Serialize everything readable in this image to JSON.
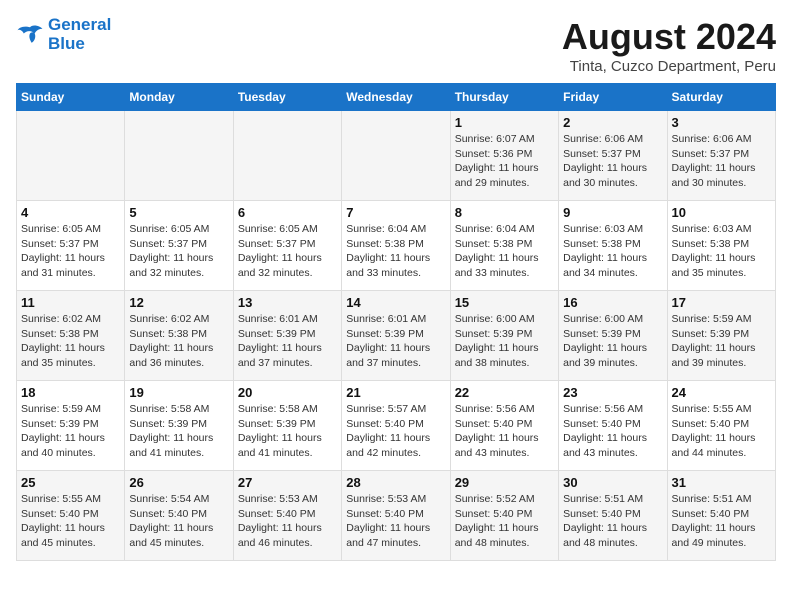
{
  "header": {
    "logo_line1": "General",
    "logo_line2": "Blue",
    "main_title": "August 2024",
    "sub_title": "Tinta, Cuzco Department, Peru"
  },
  "columns": [
    "Sunday",
    "Monday",
    "Tuesday",
    "Wednesday",
    "Thursday",
    "Friday",
    "Saturday"
  ],
  "weeks": [
    [
      {
        "day": "",
        "info": ""
      },
      {
        "day": "",
        "info": ""
      },
      {
        "day": "",
        "info": ""
      },
      {
        "day": "",
        "info": ""
      },
      {
        "day": "1",
        "info": "Sunrise: 6:07 AM\nSunset: 5:36 PM\nDaylight: 11 hours\nand 29 minutes."
      },
      {
        "day": "2",
        "info": "Sunrise: 6:06 AM\nSunset: 5:37 PM\nDaylight: 11 hours\nand 30 minutes."
      },
      {
        "day": "3",
        "info": "Sunrise: 6:06 AM\nSunset: 5:37 PM\nDaylight: 11 hours\nand 30 minutes."
      }
    ],
    [
      {
        "day": "4",
        "info": "Sunrise: 6:05 AM\nSunset: 5:37 PM\nDaylight: 11 hours\nand 31 minutes."
      },
      {
        "day": "5",
        "info": "Sunrise: 6:05 AM\nSunset: 5:37 PM\nDaylight: 11 hours\nand 32 minutes."
      },
      {
        "day": "6",
        "info": "Sunrise: 6:05 AM\nSunset: 5:37 PM\nDaylight: 11 hours\nand 32 minutes."
      },
      {
        "day": "7",
        "info": "Sunrise: 6:04 AM\nSunset: 5:38 PM\nDaylight: 11 hours\nand 33 minutes."
      },
      {
        "day": "8",
        "info": "Sunrise: 6:04 AM\nSunset: 5:38 PM\nDaylight: 11 hours\nand 33 minutes."
      },
      {
        "day": "9",
        "info": "Sunrise: 6:03 AM\nSunset: 5:38 PM\nDaylight: 11 hours\nand 34 minutes."
      },
      {
        "day": "10",
        "info": "Sunrise: 6:03 AM\nSunset: 5:38 PM\nDaylight: 11 hours\nand 35 minutes."
      }
    ],
    [
      {
        "day": "11",
        "info": "Sunrise: 6:02 AM\nSunset: 5:38 PM\nDaylight: 11 hours\nand 35 minutes."
      },
      {
        "day": "12",
        "info": "Sunrise: 6:02 AM\nSunset: 5:38 PM\nDaylight: 11 hours\nand 36 minutes."
      },
      {
        "day": "13",
        "info": "Sunrise: 6:01 AM\nSunset: 5:39 PM\nDaylight: 11 hours\nand 37 minutes."
      },
      {
        "day": "14",
        "info": "Sunrise: 6:01 AM\nSunset: 5:39 PM\nDaylight: 11 hours\nand 37 minutes."
      },
      {
        "day": "15",
        "info": "Sunrise: 6:00 AM\nSunset: 5:39 PM\nDaylight: 11 hours\nand 38 minutes."
      },
      {
        "day": "16",
        "info": "Sunrise: 6:00 AM\nSunset: 5:39 PM\nDaylight: 11 hours\nand 39 minutes."
      },
      {
        "day": "17",
        "info": "Sunrise: 5:59 AM\nSunset: 5:39 PM\nDaylight: 11 hours\nand 39 minutes."
      }
    ],
    [
      {
        "day": "18",
        "info": "Sunrise: 5:59 AM\nSunset: 5:39 PM\nDaylight: 11 hours\nand 40 minutes."
      },
      {
        "day": "19",
        "info": "Sunrise: 5:58 AM\nSunset: 5:39 PM\nDaylight: 11 hours\nand 41 minutes."
      },
      {
        "day": "20",
        "info": "Sunrise: 5:58 AM\nSunset: 5:39 PM\nDaylight: 11 hours\nand 41 minutes."
      },
      {
        "day": "21",
        "info": "Sunrise: 5:57 AM\nSunset: 5:40 PM\nDaylight: 11 hours\nand 42 minutes."
      },
      {
        "day": "22",
        "info": "Sunrise: 5:56 AM\nSunset: 5:40 PM\nDaylight: 11 hours\nand 43 minutes."
      },
      {
        "day": "23",
        "info": "Sunrise: 5:56 AM\nSunset: 5:40 PM\nDaylight: 11 hours\nand 43 minutes."
      },
      {
        "day": "24",
        "info": "Sunrise: 5:55 AM\nSunset: 5:40 PM\nDaylight: 11 hours\nand 44 minutes."
      }
    ],
    [
      {
        "day": "25",
        "info": "Sunrise: 5:55 AM\nSunset: 5:40 PM\nDaylight: 11 hours\nand 45 minutes."
      },
      {
        "day": "26",
        "info": "Sunrise: 5:54 AM\nSunset: 5:40 PM\nDaylight: 11 hours\nand 45 minutes."
      },
      {
        "day": "27",
        "info": "Sunrise: 5:53 AM\nSunset: 5:40 PM\nDaylight: 11 hours\nand 46 minutes."
      },
      {
        "day": "28",
        "info": "Sunrise: 5:53 AM\nSunset: 5:40 PM\nDaylight: 11 hours\nand 47 minutes."
      },
      {
        "day": "29",
        "info": "Sunrise: 5:52 AM\nSunset: 5:40 PM\nDaylight: 11 hours\nand 48 minutes."
      },
      {
        "day": "30",
        "info": "Sunrise: 5:51 AM\nSunset: 5:40 PM\nDaylight: 11 hours\nand 48 minutes."
      },
      {
        "day": "31",
        "info": "Sunrise: 5:51 AM\nSunset: 5:40 PM\nDaylight: 11 hours\nand 49 minutes."
      }
    ]
  ]
}
